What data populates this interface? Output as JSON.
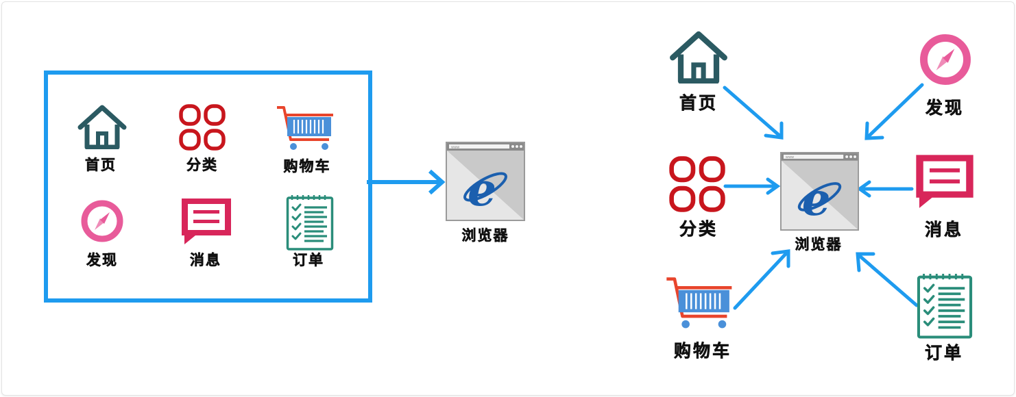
{
  "browser_label": "浏览器",
  "browser_url_text": "www",
  "modules": {
    "home": "首页",
    "category": "分类",
    "cart": "购物车",
    "discover": "发现",
    "message": "消息",
    "order": "订单"
  },
  "colors": {
    "arrow": "#1e9bef",
    "home": "#2b5a62",
    "category": "#c8161d",
    "cart_frame": "#e8452c",
    "cart_basket": "#4a90d9",
    "discover": "#e85b9a",
    "message": "#d8265a",
    "order": "#2a8d7a",
    "ie": "#1b5fae"
  }
}
